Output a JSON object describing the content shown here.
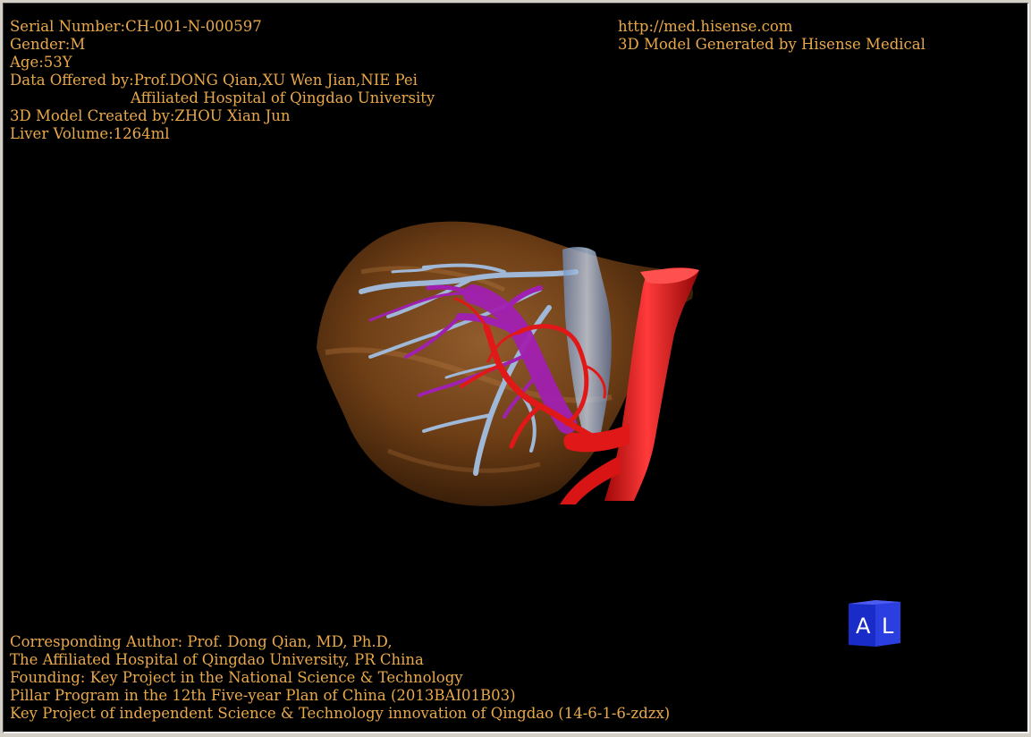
{
  "top_left_info": {
    "serial": "Serial Number:CH-001-N-000597",
    "gender": "Gender:M",
    "age": "Age:53Y",
    "data_offered": "Data Offered by:Prof.DONG Qian,XU Wen Jian,NIE Pei",
    "hospital": "Affiliated Hospital of Qingdao University",
    "model_created": "3D Model Created by:ZHOU Xian Jun",
    "liver_volume": "Liver Volume:1264ml"
  },
  "top_right_info": {
    "url": "http://med.hisense.com",
    "generated_by": "3D Model Generated by Hisense Medical"
  },
  "bottom_left_info": {
    "author": "Corresponding Author: Prof. Dong Qian, MD, Ph.D,",
    "affiliation": "The Affiliated Hospital of Qingdao University, PR China",
    "founding": "Founding: Key Project in the National Science & Technology",
    "program": "Pillar Program in the 12th Five-year Plan of China (2013BAI01B03)",
    "project": "Key Project of independent Science & Technology innovation of Qingdao (14-6-1-6-zdzx)"
  },
  "orientation_cube": {
    "left_face": "A",
    "right_face": "L"
  },
  "colors": {
    "text": "#e9a84a",
    "background": "#000000",
    "liver": "#8a5220",
    "hepatic_vein": "#9fb8d8",
    "portal_vein": "#a020b0",
    "artery": "#e01818",
    "cube": "#1a2cc8"
  }
}
